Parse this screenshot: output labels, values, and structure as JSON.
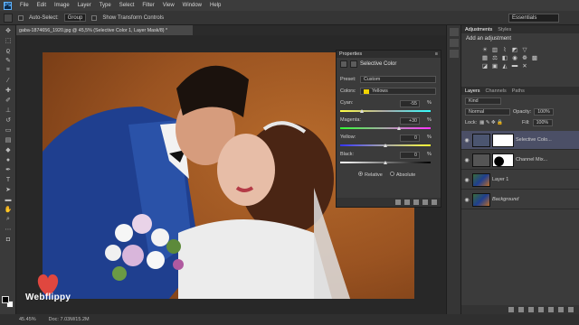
{
  "menubar": {
    "logo": "Ps",
    "items": [
      "File",
      "Edit",
      "Image",
      "Layer",
      "Type",
      "Select",
      "Filter",
      "View",
      "Window",
      "Help"
    ]
  },
  "options": {
    "auto_select_label": "Auto-Select:",
    "auto_select_value": "Group",
    "transform_label": "Show Transform Controls",
    "workspace": "Essentials"
  },
  "document": {
    "tab_title": "gaba-1874656_1920.jpg @ 45,5% (Selective Color 1, Layer Mask/8) *"
  },
  "properties": {
    "header": "Properties",
    "title": "Selective Color",
    "preset_label": "Preset:",
    "preset_value": "Custom",
    "colors_label": "Colors:",
    "colors_value": "Yellows",
    "sliders": [
      {
        "label": "Cyan:",
        "value": "-55",
        "unit": "%"
      },
      {
        "label": "Magenta:",
        "value": "+30",
        "unit": "%"
      },
      {
        "label": "Yellow:",
        "value": "0",
        "unit": "%"
      },
      {
        "label": "Black:",
        "value": "0",
        "unit": "%"
      }
    ],
    "method_relative": "Relative",
    "method_absolute": "Absolute",
    "method_selected": "Relative"
  },
  "right_panel": {
    "tabs": [
      "Adjustments",
      "Styles"
    ],
    "adjust_title": "Add an adjustment",
    "layers_tabs": [
      "Layers",
      "Channels",
      "Paths"
    ],
    "kind_label": "Kind",
    "blend_mode": "Normal",
    "opacity_label": "Opacity:",
    "opacity_value": "100%",
    "lock_label": "Lock:",
    "fill_label": "Fill:",
    "fill_value": "100%",
    "layers": [
      {
        "name": "Selective Colo...",
        "selected": true
      },
      {
        "name": "Channel Mix...",
        "selected": false
      },
      {
        "name": "Layer 1",
        "selected": false
      },
      {
        "name": "Background",
        "selected": false
      }
    ]
  },
  "status": {
    "zoom": "45.45%",
    "doc": "Doc: 7.03M/15.2M"
  },
  "watermark": {
    "text": "Webflippy"
  },
  "colors": {
    "selection": "#4b4f66",
    "yellow_swatch": "#f2d400"
  }
}
